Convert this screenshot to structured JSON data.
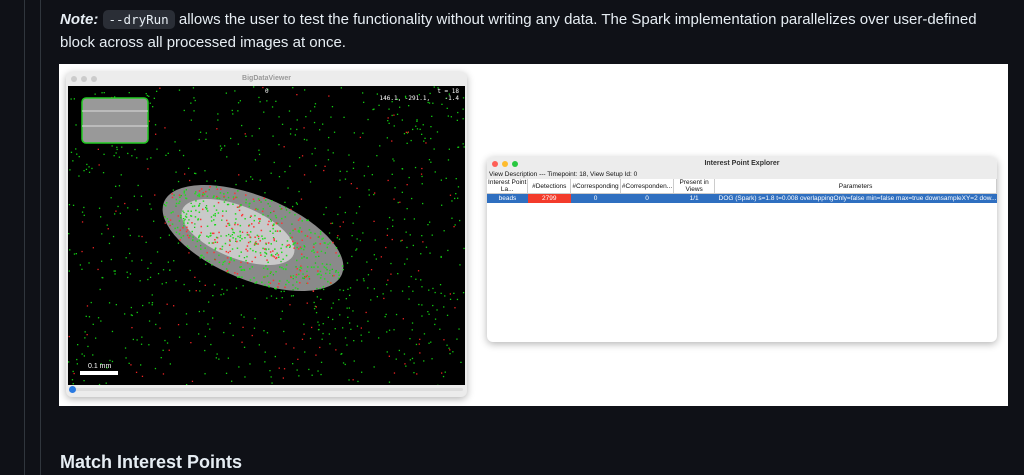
{
  "note": {
    "label": "Note:",
    "code": "--dryRun",
    "text": " allows the user to test the functionality without writing any data. The Spark implementation parallelizes over user-defined block across all processed images at once."
  },
  "bdv": {
    "title": "BigDataViewer",
    "source_index": "0",
    "time": "t = 18",
    "coords": "146.1, -291.1,    -1.4",
    "scale_bar": "0.1 mm",
    "slider_value": 0
  },
  "ipe": {
    "title": "Interest Point Explorer",
    "view_description": "View Description --- Timepoint: 18, View Setup Id: 0",
    "columns": [
      "Interest Point La...",
      "#Detections",
      "#Corresponding",
      "#Corresponden...",
      "Present in Views",
      "Parameters"
    ],
    "rows": [
      [
        "beads",
        "2799",
        "0",
        "0",
        "1/1",
        "DOG (Spark) s=1.8 t=0.008 overlappingOnly=false min=false max=true downsampleXY=2 dow..."
      ]
    ]
  },
  "heading": "Match Interest Points",
  "colors": {
    "selected_row": "#2f6fc0",
    "detections_cell": "#f33b2b"
  }
}
